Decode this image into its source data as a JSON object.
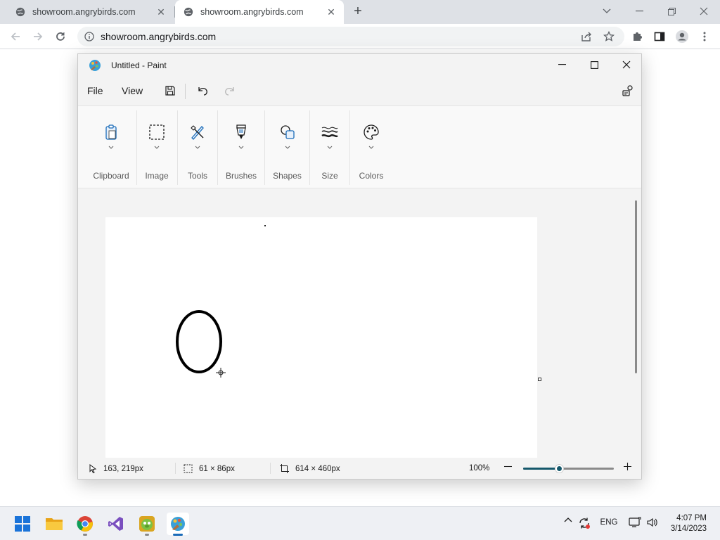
{
  "browser": {
    "tabs": [
      {
        "title": "showroom.angrybirds.com",
        "active": false
      },
      {
        "title": "showroom.angrybirds.com",
        "active": true
      }
    ],
    "url": "showroom.angrybirds.com"
  },
  "paint": {
    "window_title": "Untitled - Paint",
    "menu": {
      "file": "File",
      "view": "View"
    },
    "ribbon": {
      "clipboard": "Clipboard",
      "image": "Image",
      "tools": "Tools",
      "brushes": "Brushes",
      "shapes": "Shapes",
      "size": "Size",
      "colors": "Colors"
    },
    "status": {
      "cursor_position": "163, 219px",
      "selection_size": "61 × 86px",
      "canvas_size": "614 × 460px",
      "zoom": "100%",
      "zoom_slider_fraction": 0.4
    }
  },
  "taskbar": {
    "language": "ENG",
    "time": "4:07 PM",
    "date": "3/14/2023"
  },
  "colors": {
    "zoom_accent": "#15586b",
    "active_indicator": "#1a6bb8"
  }
}
